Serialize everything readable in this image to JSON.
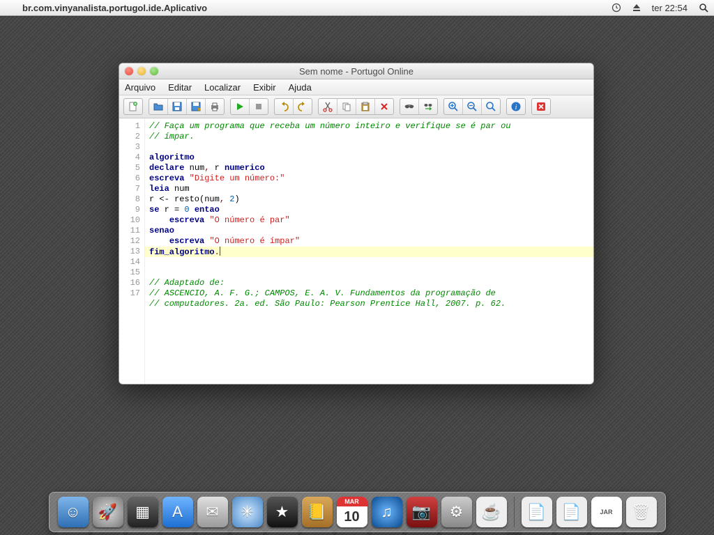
{
  "menubar": {
    "app_title": "br.com.vinyanalista.portugol.ide.Aplicativo",
    "clock": "ter 22:54"
  },
  "window": {
    "title": "Sem nome - Portugol Online",
    "menu": [
      "Arquivo",
      "Editar",
      "Localizar",
      "Exibir",
      "Ajuda"
    ]
  },
  "toolbar_icons": [
    "new-file",
    "open-file",
    "save",
    "save-as",
    "print",
    "run",
    "stop",
    "undo",
    "redo",
    "cut",
    "copy",
    "paste",
    "delete",
    "find",
    "find-replace",
    "zoom-in",
    "zoom-out",
    "zoom-reset",
    "info",
    "close"
  ],
  "code_lines": [
    [
      {
        "t": "// Faça um programa que receba um número inteiro e verifique se é par ou",
        "c": "comment"
      }
    ],
    [
      {
        "t": "// ímpar.",
        "c": "comment"
      }
    ],
    [],
    [
      {
        "t": "algoritmo",
        "c": "kw"
      }
    ],
    [
      {
        "t": "declare",
        "c": "kw"
      },
      {
        "t": " num"
      },
      {
        "t": ",",
        "c": "punct"
      },
      {
        "t": " r "
      },
      {
        "t": "numerico",
        "c": "kw"
      }
    ],
    [
      {
        "t": "escreva",
        "c": "kw"
      },
      {
        "t": " "
      },
      {
        "t": "\"Digite um número:\"",
        "c": "str"
      }
    ],
    [
      {
        "t": "leia",
        "c": "kw"
      },
      {
        "t": " num"
      }
    ],
    [
      {
        "t": "r <- resto(num"
      },
      {
        "t": ",",
        "c": "punct"
      },
      {
        "t": " "
      },
      {
        "t": "2",
        "c": "num"
      },
      {
        "t": ")"
      }
    ],
    [
      {
        "t": "se",
        "c": "kw"
      },
      {
        "t": " r = "
      },
      {
        "t": "0",
        "c": "num"
      },
      {
        "t": " "
      },
      {
        "t": "entao",
        "c": "kw"
      }
    ],
    [
      {
        "t": "    "
      },
      {
        "t": "escreva",
        "c": "kw"
      },
      {
        "t": " "
      },
      {
        "t": "\"O número é par\"",
        "c": "str"
      }
    ],
    [
      {
        "t": "senao",
        "c": "kw"
      }
    ],
    [
      {
        "t": "    "
      },
      {
        "t": "escreva",
        "c": "kw"
      },
      {
        "t": " "
      },
      {
        "t": "\"O número é ímpar\"",
        "c": "str"
      }
    ],
    [
      {
        "t": "fim_algoritmo",
        "c": "kw"
      },
      {
        "t": ".",
        "c": "punct"
      }
    ],
    [],
    [
      {
        "t": "// Adaptado de:",
        "c": "comment"
      }
    ],
    [
      {
        "t": "// ASCENCIO, A. F. G.; CAMPOS, E. A. V. Fundamentos da programação de",
        "c": "comment"
      }
    ],
    [
      {
        "t": "// computadores. 2a. ed. São Paulo: Pearson Prentice Hall, 2007. p. 62.",
        "c": "comment"
      }
    ]
  ],
  "highlight_line": 13,
  "dock": [
    {
      "name": "finder",
      "bg": "linear-gradient(#7fb5ea,#2e6fb5)",
      "glyph": "☺"
    },
    {
      "name": "launchpad",
      "bg": "radial-gradient(circle,#ddd,#777)",
      "glyph": "🚀"
    },
    {
      "name": "mission-control",
      "bg": "linear-gradient(#666,#222)",
      "glyph": "▦"
    },
    {
      "name": "app-store",
      "bg": "linear-gradient(#6fb4ff,#1d6fd1)",
      "glyph": "A"
    },
    {
      "name": "mail",
      "bg": "linear-gradient(#e0e0e0,#9a9a9a)",
      "glyph": "✉"
    },
    {
      "name": "safari",
      "bg": "radial-gradient(circle,#cfe8ff,#4a88c7)",
      "glyph": "✳"
    },
    {
      "name": "itunes-store",
      "bg": "linear-gradient(#555,#111)",
      "glyph": "★"
    },
    {
      "name": "contacts",
      "bg": "linear-gradient(#d9a85a,#a56f28)",
      "glyph": "📒"
    },
    {
      "name": "calendar",
      "bg": "#fff",
      "glyph": "cal"
    },
    {
      "name": "itunes",
      "bg": "radial-gradient(circle,#6cb7ff,#0a4a8f)",
      "glyph": "♫"
    },
    {
      "name": "photo-booth",
      "bg": "linear-gradient(#d04040,#7a1010)",
      "glyph": "📷"
    },
    {
      "name": "preferences",
      "bg": "linear-gradient(#ccc,#888)",
      "glyph": "⚙"
    },
    {
      "name": "java",
      "bg": "#efefef",
      "glyph": "☕"
    }
  ],
  "dock_right": [
    {
      "name": "document-1",
      "glyph": "📄"
    },
    {
      "name": "document-2",
      "glyph": "📄"
    },
    {
      "name": "jar",
      "glyph": "JAR"
    },
    {
      "name": "trash",
      "glyph": "🗑"
    }
  ],
  "calendar": {
    "month": "MAR",
    "day": "10"
  }
}
